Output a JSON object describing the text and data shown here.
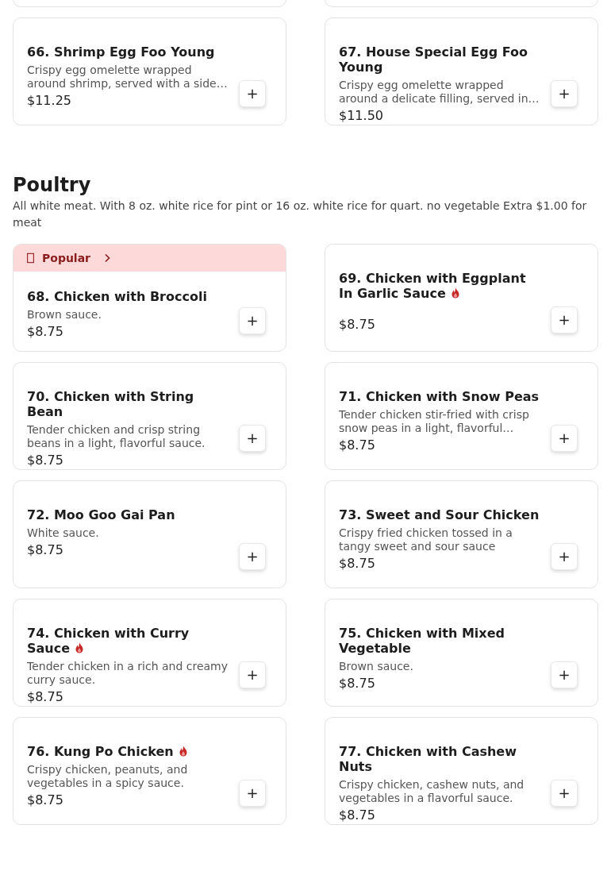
{
  "sections": [
    {
      "items": [
        {
          "title": "66. Shrimp Egg Foo Young",
          "spicy": false,
          "description": "Crispy egg omelette wrapped around shrimp, served with a side…",
          "price": "$11.25",
          "add": "+"
        },
        {
          "title": "67. House Special Egg Foo Young",
          "spicy": false,
          "description": "Crispy egg omelette wrapped around a delicate filling, served in…",
          "price": "$11.50",
          "add": "+"
        }
      ]
    },
    {
      "heading": "Poultry",
      "note": "All white meat. With 8 oz. white rice for pint or 16 oz. white rice for quart. no vegetable Extra $1.00 for meat",
      "items": [
        {
          "badge": "Popular",
          "title": "68. Chicken with Broccoli",
          "spicy": false,
          "description": "Brown sauce.",
          "price": "$8.75",
          "add": "+"
        },
        {
          "title": "69. Chicken with Eggplant In Garlic Sauce",
          "spicy": true,
          "price": "$8.75",
          "add": "+"
        },
        {
          "title": "70. Chicken with String Bean",
          "spicy": false,
          "description": "Tender chicken and crisp string beans in a light, flavorful sauce.",
          "price": "$8.75",
          "add": "+"
        },
        {
          "title": "71. Chicken with Snow Peas",
          "spicy": false,
          "description": "Tender chicken stir-fried with crisp snow peas in a light, flavorful…",
          "price": "$8.75",
          "add": "+"
        },
        {
          "title": "72. Moo Goo Gai Pan",
          "spicy": false,
          "description": "White sauce.",
          "price": "$8.75",
          "add": "+"
        },
        {
          "title": "73. Sweet and Sour Chicken",
          "spicy": false,
          "description": "Crispy fried chicken tossed in a tangy sweet and sour sauce",
          "price": "$8.75",
          "add": "+"
        },
        {
          "title": "74. Chicken with Curry Sauce",
          "spicy": true,
          "description": "Tender chicken in a rich and creamy curry sauce.",
          "price": "$8.75",
          "add": "+"
        },
        {
          "title": "75. Chicken with Mixed Vegetable",
          "spicy": false,
          "description": "Brown sauce.",
          "price": "$8.75",
          "add": "+"
        },
        {
          "title": "76. Kung Po Chicken",
          "spicy": true,
          "description": "Crispy chicken, peanuts, and vegetables in a spicy sauce.",
          "price": "$8.75",
          "add": "+"
        },
        {
          "title": "77. Chicken with Cashew Nuts",
          "spicy": false,
          "description": "Crispy chicken, cashew nuts, and vegetables in a flavorful sauce.",
          "price": "$8.75",
          "add": "+"
        }
      ]
    }
  ]
}
